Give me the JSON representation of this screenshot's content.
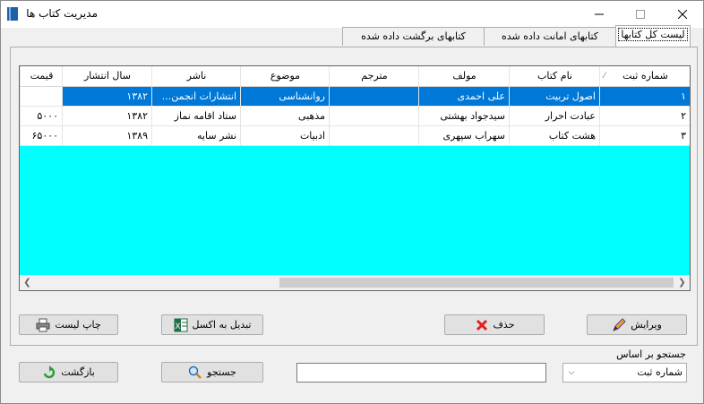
{
  "window": {
    "title": "مدیریت کتاب ها"
  },
  "tabs": [
    {
      "label": "لیست کل کتابها",
      "active": true
    },
    {
      "label": "کتابهای امانت داده شده",
      "active": false
    },
    {
      "label": "کتابهای برگشت داده شده",
      "active": false
    }
  ],
  "grid": {
    "columns": [
      "شماره ثبت",
      "نام کتاب",
      "مولف",
      "مترجم",
      "موضوع",
      "ناشر",
      "سال انتشار",
      "قیمت"
    ],
    "rows": [
      [
        "۱",
        "اصول تربیت",
        "علی احمدی",
        "",
        "روانشناسی",
        "انتشارات انجمن...",
        "۱۳۸۲",
        ""
      ],
      [
        "۲",
        "عبادت احرار",
        "سیدجواد بهشتی",
        "",
        "مذهبی",
        "ستاد اقامه نماز",
        "۱۳۸۲",
        "۵۰۰۰"
      ],
      [
        "۳",
        "هشت کتاب",
        "سهراب سپهری",
        "",
        "ادبیات",
        "نشر سایه",
        "۱۳۸۹",
        "۶۵۰۰۰"
      ]
    ],
    "selected_row": 0
  },
  "buttons": {
    "edit": "ویرایش",
    "delete": "حذف",
    "export_excel": "تبدیل به اکسل",
    "print_list": "چاپ لیست",
    "search": "جستجو",
    "back": "بازگشت"
  },
  "search": {
    "label": "جستجو بر اساس",
    "field_selected": "شماره ثبت",
    "query_value": ""
  },
  "colors": {
    "grid_bg": "#00ffff",
    "selection": "#0078d7"
  }
}
